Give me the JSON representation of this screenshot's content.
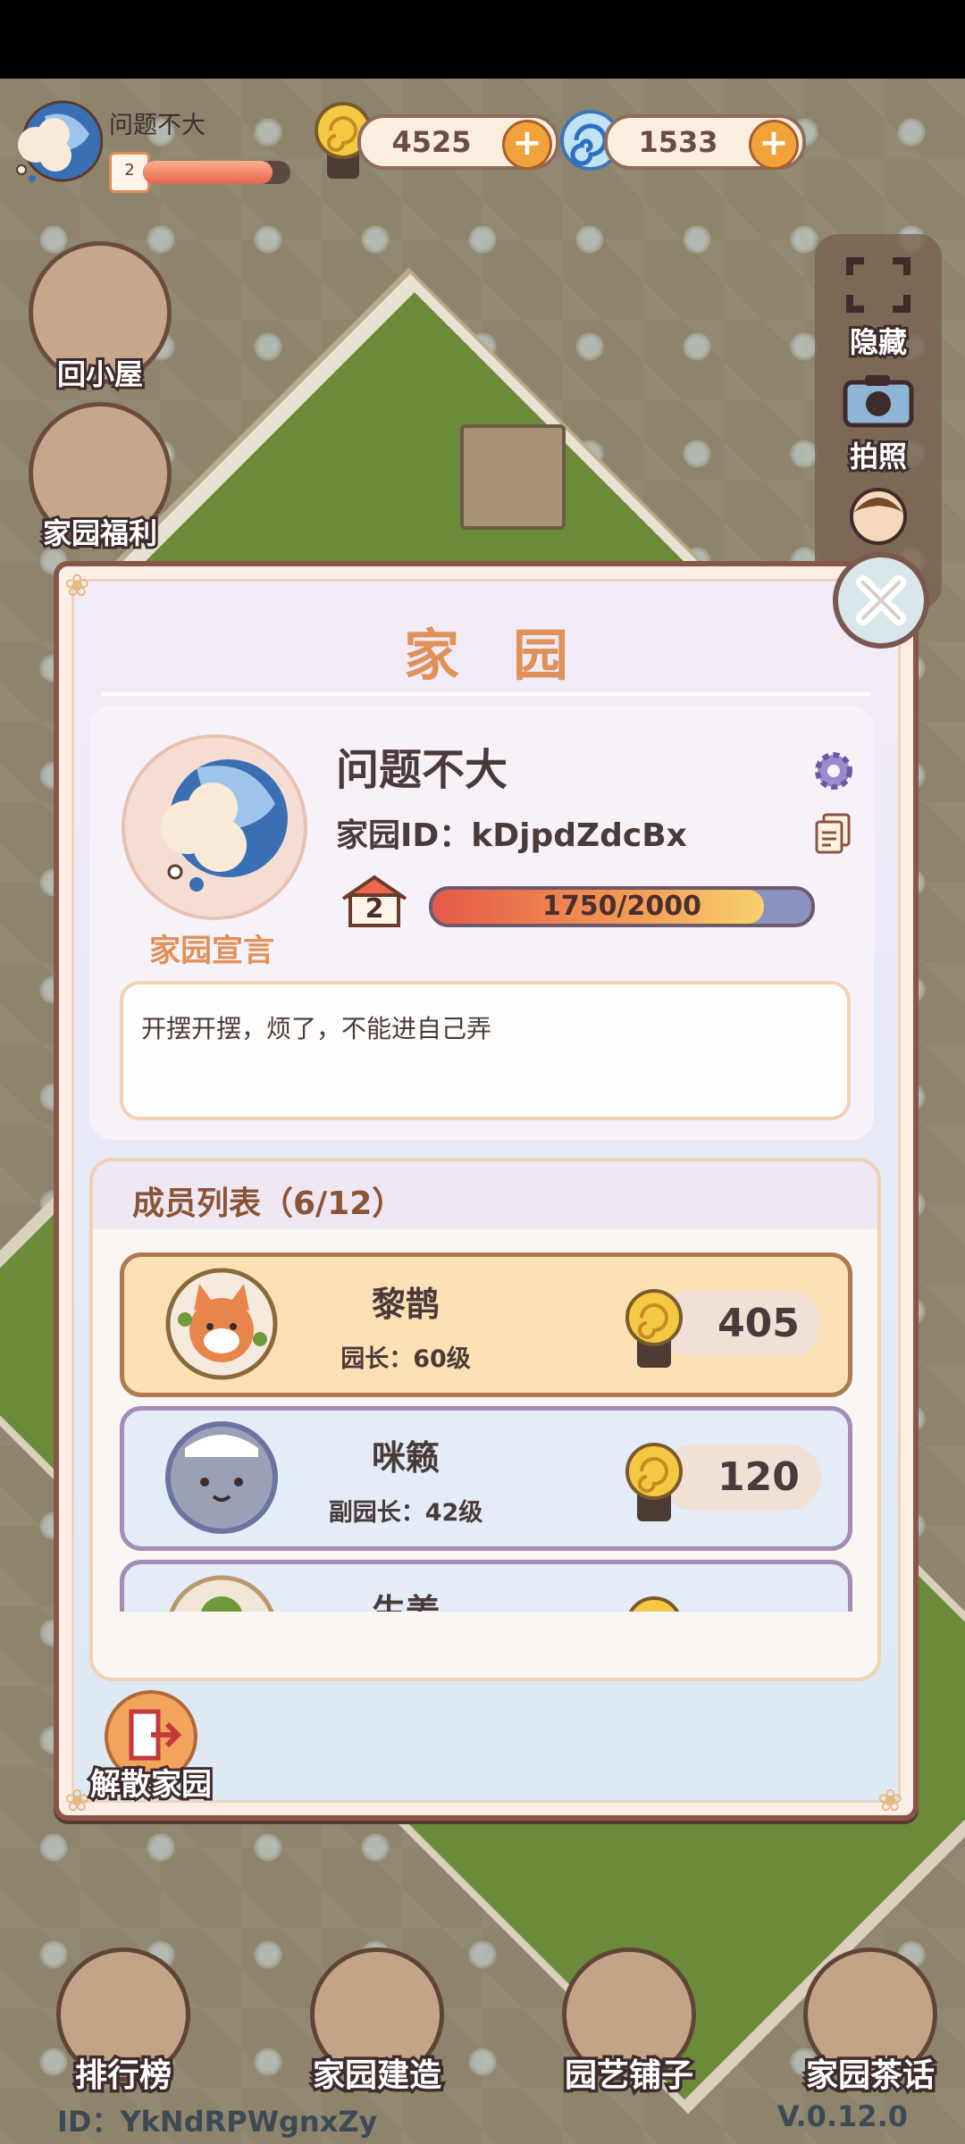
{
  "player": {
    "name": "问题不大",
    "level": "2"
  },
  "currency": {
    "coins": "4525",
    "swirls": "1533"
  },
  "left_buttons": [
    {
      "label": "回小屋"
    },
    {
      "label": "家园福利"
    }
  ],
  "right_panel": [
    {
      "label": "隐藏"
    },
    {
      "label": "拍照"
    }
  ],
  "dialog": {
    "title": "家园",
    "home_name": "问题不大",
    "home_id": "家园ID：kDjpdZdcBx",
    "home_level": "2",
    "exp_text": "1750/2000",
    "exp_fraction": 0.875,
    "manifesto_label": "家园宣言",
    "manifesto_text": "开摆开摆，烦了，不能进自己弄",
    "members_title": "成员列表（6/12）",
    "members": [
      {
        "name": "黎鹊",
        "role": "园长：60级",
        "score": "405"
      },
      {
        "name": "咪籁",
        "role": "副园长：42级",
        "score": "120"
      },
      {
        "name": "生姜",
        "role": "",
        "score": ""
      }
    ],
    "dissolve_label": "解散家园"
  },
  "bottom_nav": [
    {
      "label": "排行榜"
    },
    {
      "label": "家园建造"
    },
    {
      "label": "园艺铺子"
    },
    {
      "label": "家园茶话"
    }
  ],
  "footer": {
    "id": "ID：YkNdRPWgnxZy",
    "version": "V.0.12.0"
  },
  "colors": {
    "accent_orange": "#e0915a",
    "brown_outline": "#8a5547",
    "exp_fill": "#e45a47"
  }
}
